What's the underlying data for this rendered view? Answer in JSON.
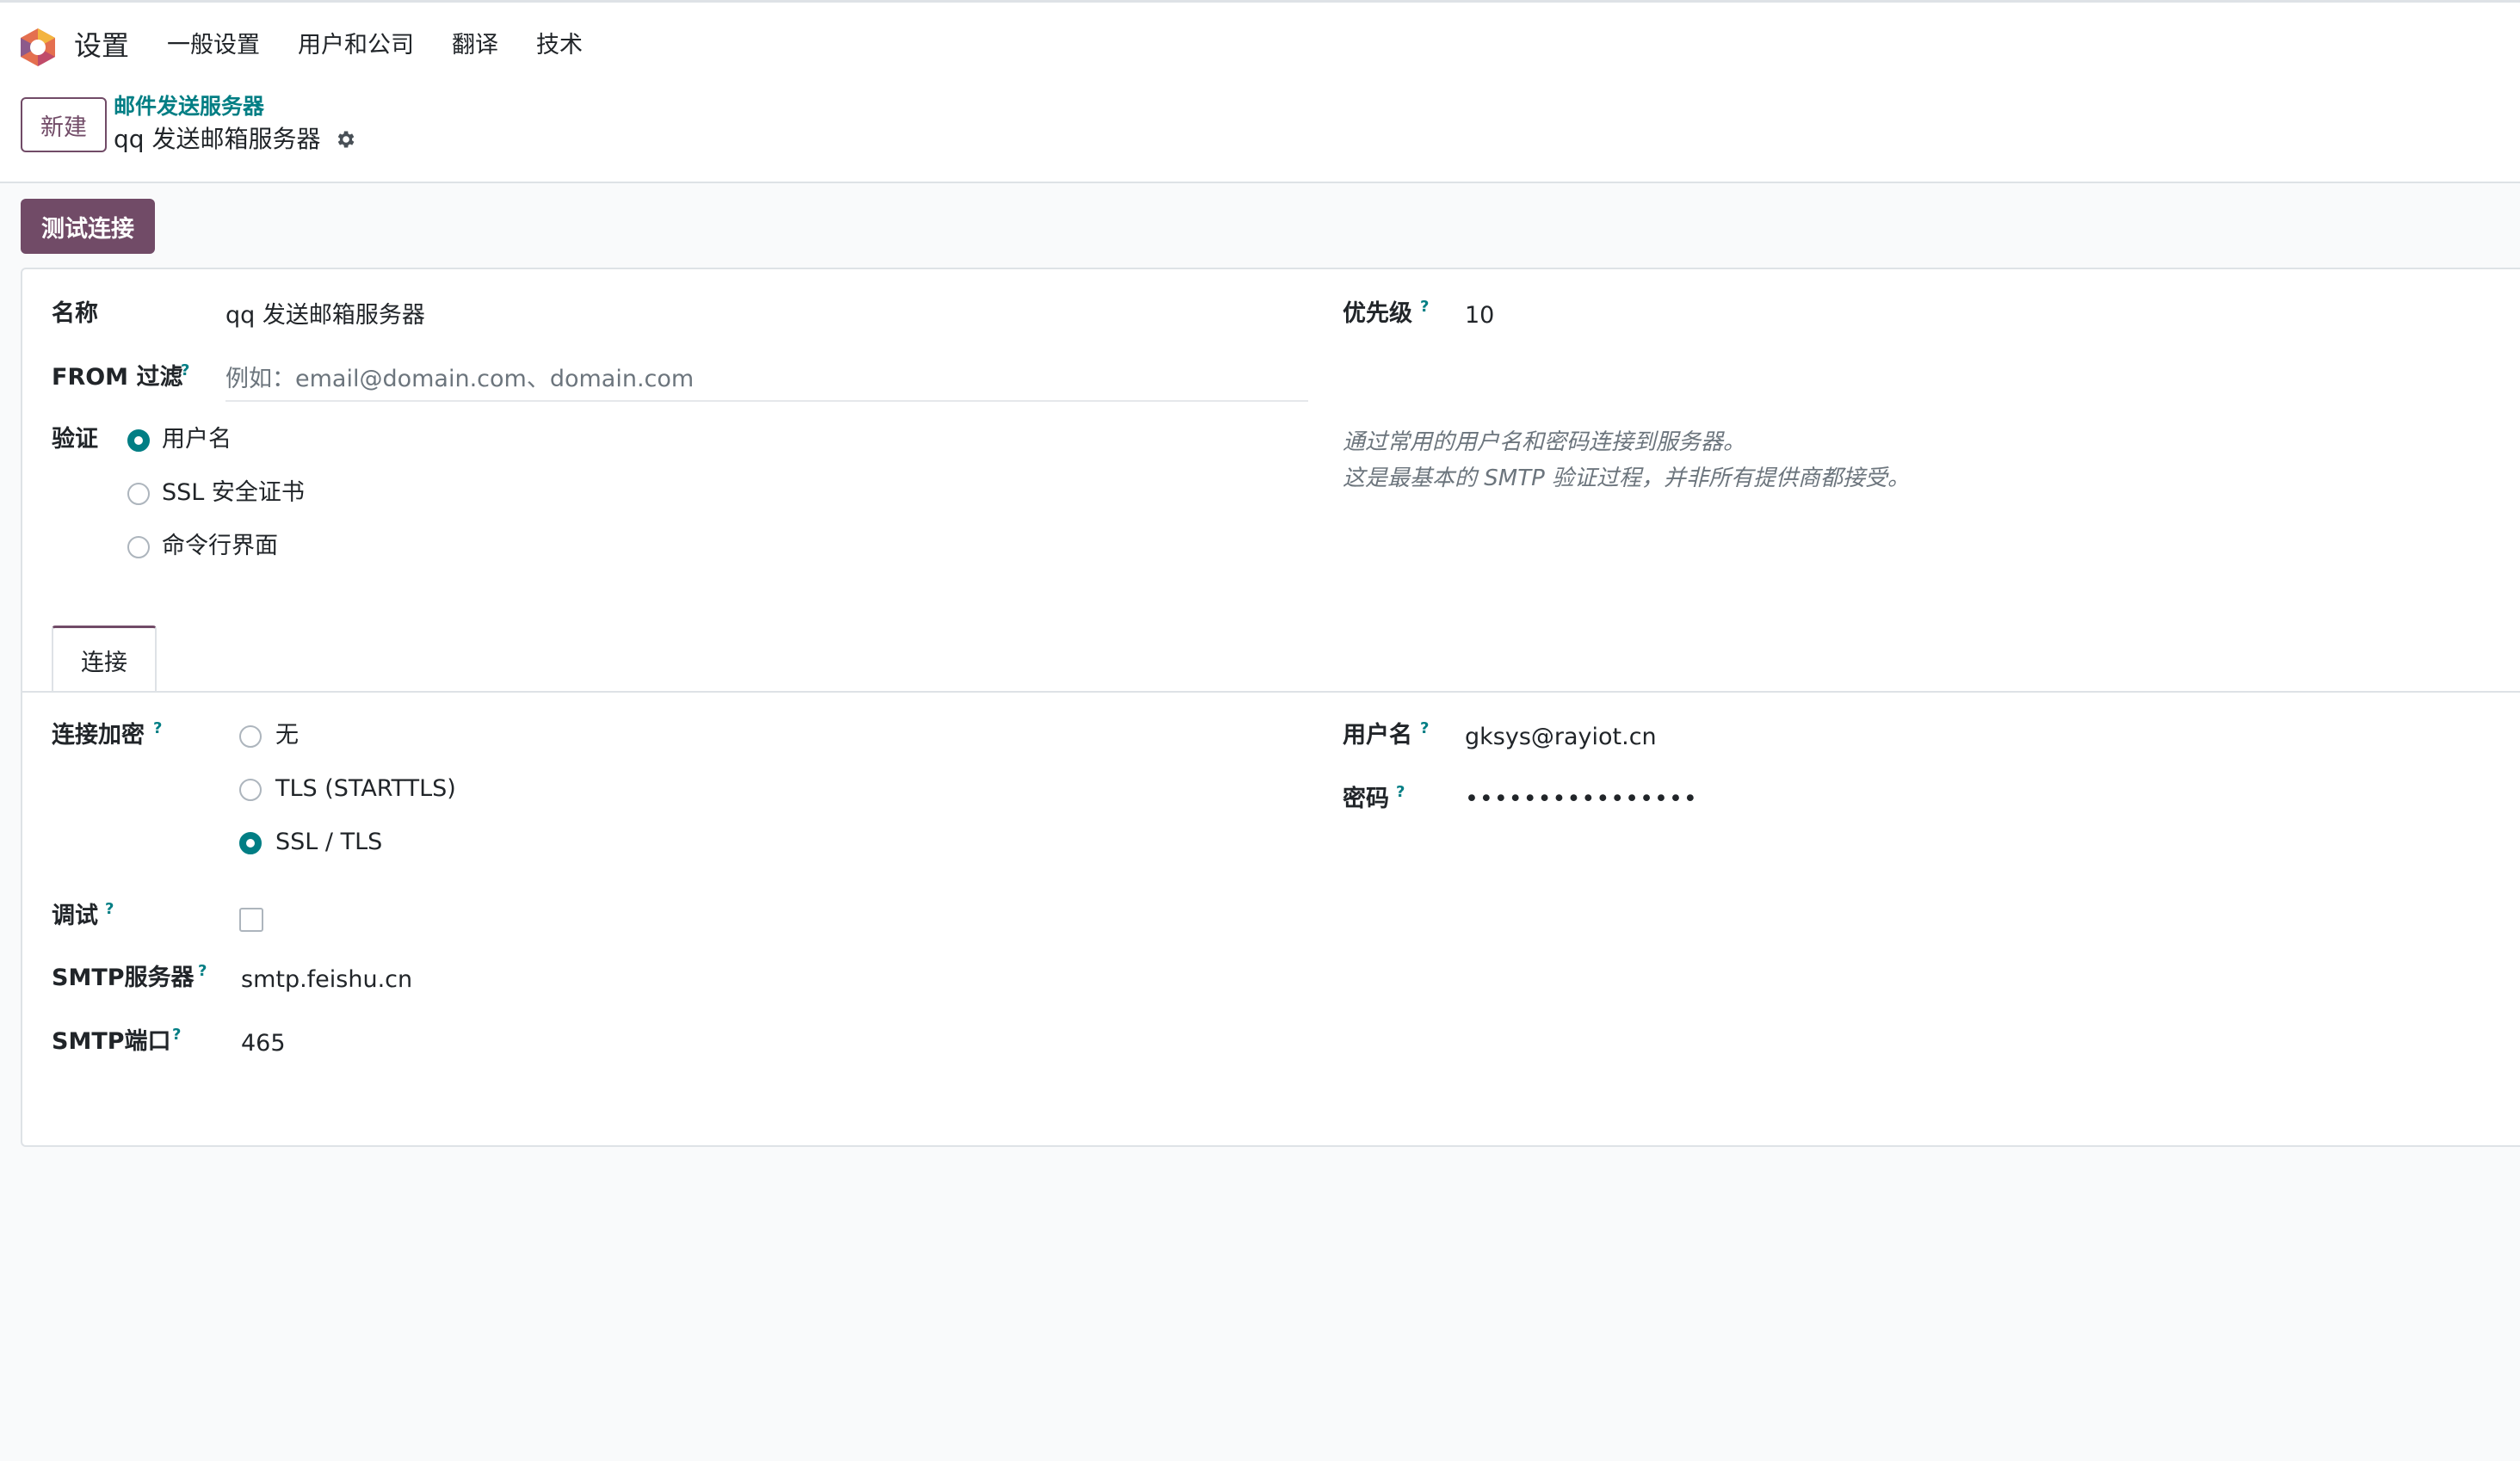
{
  "nav": {
    "app_title": "设置",
    "items": [
      "一般设置",
      "用户和公司",
      "翻译",
      "技术"
    ]
  },
  "control_panel": {
    "new_button": "新建",
    "breadcrumb": "邮件发送服务器",
    "record_title": "qq 发送邮箱服务器"
  },
  "actions": {
    "test_connection": "测试连接"
  },
  "form": {
    "name_label": "名称",
    "name_value": "qq 发送邮箱服务器",
    "from_filter_label": "FROM 过滤",
    "from_filter_placeholder": "例如：email@domain.com、domain.com",
    "priority_label": "优先级",
    "priority_value": "10",
    "auth_label": "验证",
    "auth_options": [
      "用户名",
      "SSL 安全证书",
      "命令行界面"
    ],
    "auth_selected": "用户名",
    "auth_hint_line1": "通过常用的用户名和密码连接到服务器。",
    "auth_hint_line2": "这是最基本的 SMTP 验证过程，并非所有提供商都接受。",
    "help_mark": "?"
  },
  "tabs": {
    "connection": "连接"
  },
  "connection": {
    "encryption_label": "连接加密",
    "encryption_options": [
      "无",
      "TLS (STARTTLS)",
      "SSL / TLS"
    ],
    "encryption_selected": "SSL / TLS",
    "debug_label": "调试",
    "debug_checked": false,
    "smtp_server_label": "SMTP服务器",
    "smtp_server_value": "smtp.feishu.cn",
    "smtp_port_label": "SMTP端口",
    "smtp_port_value": "465",
    "username_label": "用户名",
    "username_value": "gksys@rayiot.cn",
    "password_label": "密码",
    "password_value": "••••••••••••••••"
  },
  "colors": {
    "brand": "#714b67",
    "accent": "#017e84"
  }
}
